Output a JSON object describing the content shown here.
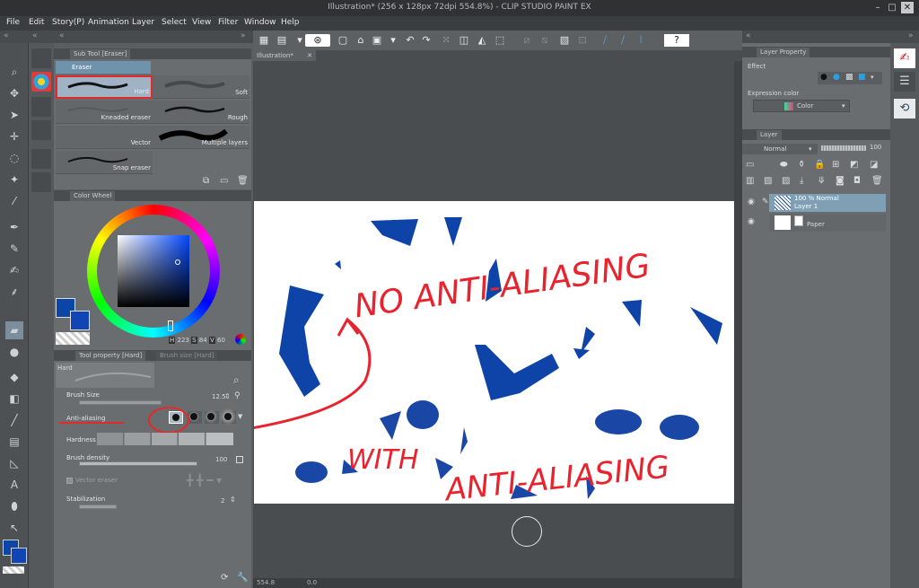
{
  "window": {
    "title": "Illustration* (256 x 128px 72dpi 554.8%) - CLIP STUDIO PAINT EX"
  },
  "menu": [
    "File",
    "Edit",
    "Story(P)",
    "Animation",
    "Layer",
    "Select",
    "View",
    "Filter",
    "Window",
    "Help"
  ],
  "subtool_panel": {
    "tab": "Sub Tool [Eraser]",
    "group": "Eraser",
    "brushes": [
      "Hard",
      "Soft",
      "Kneaded eraser",
      "Rough",
      "Vector",
      "Multiple layers",
      "Snap eraser"
    ]
  },
  "color_wheel_panel": {
    "tab": "Color Wheel",
    "h_label": "H",
    "h_value": "223",
    "s_label": "S",
    "s_value": "84",
    "v_label": "V",
    "v_value": "60",
    "colors": {
      "main": "#0b46a7",
      "sub": "#1145b3"
    }
  },
  "tool_property_panel": {
    "tabs": [
      "Tool property [Hard]",
      "Brush size [Hard]"
    ],
    "preset_name": "Hard",
    "brush_size_label": "Brush Size",
    "brush_size_value": "12.5",
    "anti_aliasing_label": "Anti-aliasing",
    "hardness_label": "Hardness",
    "brush_density_label": "Brush density",
    "brush_density_value": "100",
    "vector_eraser_label": "Vector eraser",
    "stabilization_label": "Stabilization",
    "stabilization_value": "2"
  },
  "canvas": {
    "tab": "Illustration*",
    "zoom": "554.8",
    "angle": "0.0",
    "annotations": {
      "top": "NO ANTI-ALIASING",
      "bottom_left": "WITH",
      "bottom_right": "ANTI-ALIASING"
    },
    "paint_color": "#0e43a8",
    "annotation_color": "#e8232d"
  },
  "layer_property_panel": {
    "tab": "Layer Property",
    "effect_label": "Effect",
    "expression_color_label": "Expression color",
    "expression_color_value": "Color"
  },
  "layer_panel": {
    "tab": "Layer",
    "blend_mode": "Normal",
    "opacity": "100",
    "layers": [
      {
        "line1": "100 % Normal",
        "line2": "Layer 1"
      },
      {
        "line1": "Paper",
        "line2": ""
      }
    ]
  }
}
